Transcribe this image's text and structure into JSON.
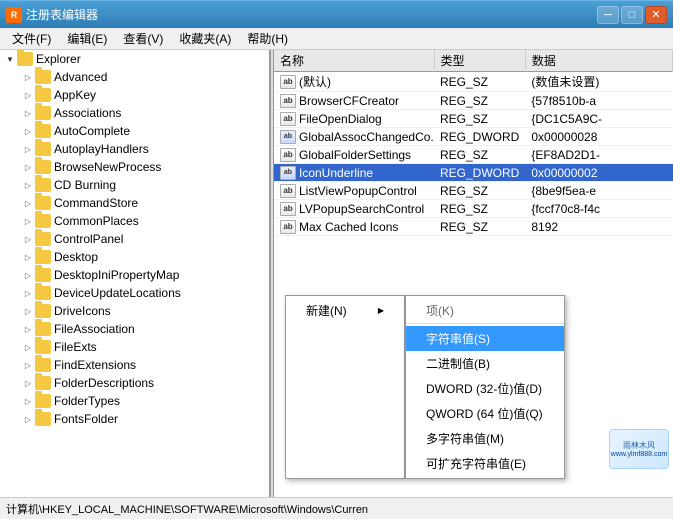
{
  "window": {
    "title": "注册表编辑器",
    "icon_label": "R"
  },
  "title_buttons": {
    "minimize": "─",
    "maximize": "□",
    "close": "✕"
  },
  "menu": {
    "items": [
      {
        "label": "文件(F)"
      },
      {
        "label": "编辑(E)"
      },
      {
        "label": "查看(V)"
      },
      {
        "label": "收藏夹(A)"
      },
      {
        "label": "帮助(H)"
      }
    ]
  },
  "tree": {
    "items": [
      {
        "label": "Explorer",
        "level": 0,
        "expanded": true,
        "selected": false,
        "is_root": true
      },
      {
        "label": "Advanced",
        "level": 1,
        "expanded": false
      },
      {
        "label": "AppKey",
        "level": 1,
        "expanded": false
      },
      {
        "label": "Associations",
        "level": 1,
        "expanded": false
      },
      {
        "label": "AutoComplete",
        "level": 1,
        "expanded": false
      },
      {
        "label": "AutoplayHandlers",
        "level": 1,
        "expanded": false
      },
      {
        "label": "BrowseNewProcess",
        "level": 1,
        "expanded": false
      },
      {
        "label": "CD Burning",
        "level": 1,
        "expanded": false
      },
      {
        "label": "CommandStore",
        "level": 1,
        "expanded": false
      },
      {
        "label": "CommonPlaces",
        "level": 1,
        "expanded": false
      },
      {
        "label": "ControlPanel",
        "level": 1,
        "expanded": false
      },
      {
        "label": "Desktop",
        "level": 1,
        "expanded": false
      },
      {
        "label": "DesktopIniPropertyMap",
        "level": 1,
        "expanded": false
      },
      {
        "label": "DeviceUpdateLocations",
        "level": 1,
        "expanded": false
      },
      {
        "label": "DriveIcons",
        "level": 1,
        "expanded": false
      },
      {
        "label": "FileAssociation",
        "level": 1,
        "expanded": false
      },
      {
        "label": "FileExts",
        "level": 1,
        "expanded": false
      },
      {
        "label": "FindExtensions",
        "level": 1,
        "expanded": false
      },
      {
        "label": "FolderDescriptions",
        "level": 1,
        "expanded": false
      },
      {
        "label": "FolderTypes",
        "level": 1,
        "expanded": false
      },
      {
        "label": "FontsFolder",
        "level": 1,
        "expanded": false
      }
    ]
  },
  "columns": {
    "name": "名称",
    "type": "类型",
    "data": "数据"
  },
  "rows": [
    {
      "name": "(默认)",
      "type": "REG_SZ",
      "data": "(数值未设置)",
      "icon": "ab"
    },
    {
      "name": "BrowserCFCreator",
      "type": "REG_SZ",
      "data": "{57f8510b-a",
      "icon": "ab"
    },
    {
      "name": "FileOpenDialog",
      "type": "REG_SZ",
      "data": "{DC1C5A9C-",
      "icon": "ab"
    },
    {
      "name": "GlobalAssocChangedCo...",
      "type": "REG_DWORD",
      "data": "0x00000028",
      "icon": "dword"
    },
    {
      "name": "GlobalFolderSettings",
      "type": "REG_SZ",
      "data": "{EF8AD2D1-",
      "icon": "ab"
    },
    {
      "name": "IconUnderline",
      "type": "REG_DWORD",
      "data": "0x00000002",
      "icon": "dword",
      "highlighted": true
    },
    {
      "name": "ListViewPopupControl",
      "type": "REG_SZ",
      "data": "{8be9f5ea-e",
      "icon": "ab"
    },
    {
      "name": "LVPopupSearchControl",
      "type": "REG_SZ",
      "data": "{fccf70c8-f4c",
      "icon": "ab"
    },
    {
      "name": "Max Cached Icons",
      "type": "REG_SZ",
      "data": "8192",
      "icon": "ab"
    }
  ],
  "context_menu": {
    "new_label": "新建(N)",
    "arrow": "▶",
    "submenu_header": "项(K)",
    "items": [
      {
        "label": "字符串值(S)",
        "highlighted": true
      },
      {
        "label": "二进制值(B)"
      },
      {
        "label": "DWORD (32-位)值(D)"
      },
      {
        "label": "QWORD (64 位)值(Q)"
      },
      {
        "label": "多字符串值(M)"
      },
      {
        "label": "可扩充字符串值(E)"
      }
    ]
  },
  "status_bar": {
    "text": "计算机\\HKEY_LOCAL_MACHINE\\SOFTWARE\\Microsoft\\Windows\\Curren"
  },
  "watermark": {
    "line1": "雨林木风",
    "line2": "www.ylmf888.com"
  }
}
